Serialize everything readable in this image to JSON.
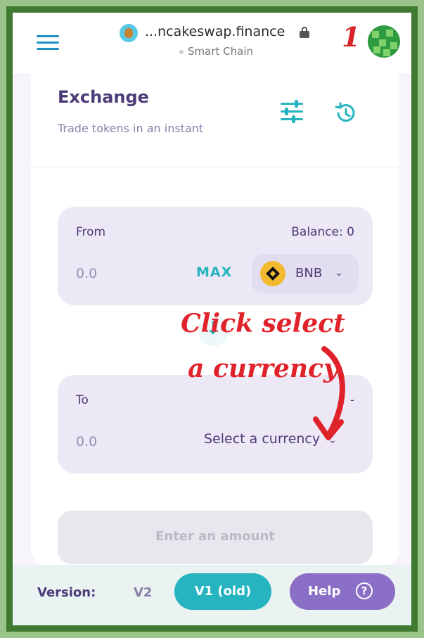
{
  "browser": {
    "url": "...ncakeswap.finance",
    "network": "Smart Chain"
  },
  "annotation": {
    "step_number": "1",
    "instruction_line1": "Click select",
    "instruction_line2": "a currency",
    "color": "#e0232a"
  },
  "exchange": {
    "title": "Exchange",
    "subtitle": "Trade tokens in an instant",
    "icons": [
      "settings-sliders-icon",
      "history-icon"
    ]
  },
  "from_panel": {
    "label": "From",
    "balance": "Balance: 0",
    "amount_placeholder": "0.0",
    "max_label": "MAX",
    "token": "BNB"
  },
  "to_panel": {
    "label": "To",
    "balance": "-",
    "amount_placeholder": "0.0",
    "select_label": "Select a currency"
  },
  "submit": {
    "label": "Enter an amount"
  },
  "footer": {
    "version_label": "Version:",
    "v2_label": "V2",
    "v1_label": "V1 (old)",
    "help_label": "Help"
  },
  "colors": {
    "accent": "#26b4c0",
    "primary_text": "#4b3b77",
    "help_button": "#8b6fc6",
    "bnb": "#f3ba2f"
  }
}
